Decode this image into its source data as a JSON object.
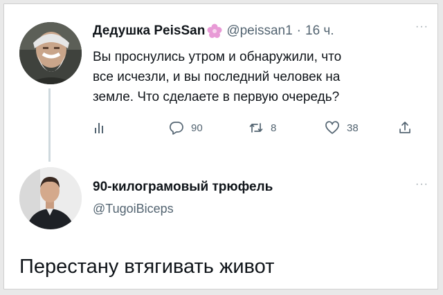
{
  "tweet": {
    "author_name": "Дедушка PeisSan",
    "handle": "@peissan1",
    "separator": "·",
    "time": "16 ч.",
    "more": "···",
    "lines": [
      "Вы проснулись утром и обнаружили, что",
      "все исчезли, и вы последний человек на",
      "земле. Что сделаете в первую очередь?"
    ],
    "actions": {
      "replies": "90",
      "retweets": "8",
      "likes": "38"
    }
  },
  "reply": {
    "author_name": "90-килограмовый трюфель",
    "handle": "@TugoiBiceps",
    "more": "···",
    "text": "Перестану втягивать живот"
  },
  "colors": {
    "text": "#0f1419",
    "secondary": "#536471",
    "thread_line": "#cfd9de",
    "flower": "#e89ad6"
  }
}
